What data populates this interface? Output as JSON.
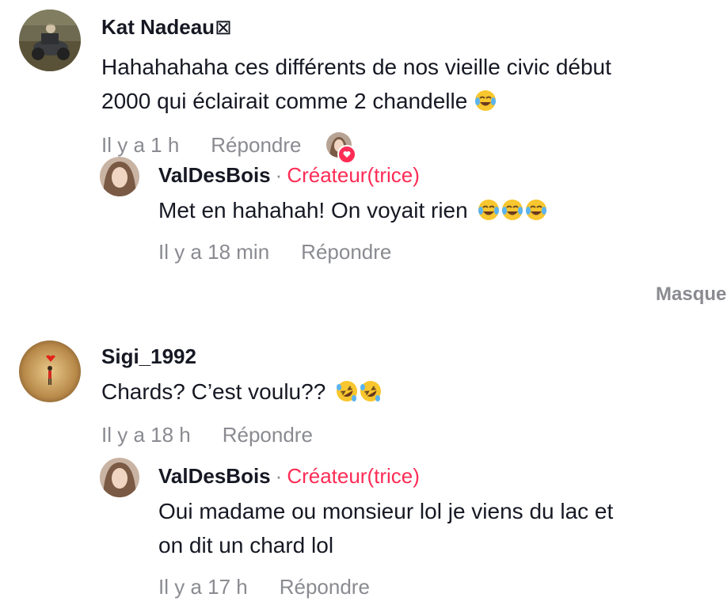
{
  "comments": [
    {
      "username": "Kat Nadeau",
      "username_suffix_glyph": "⊠",
      "text_line1": "Hahahahaha ces différents de nos vieille civic début",
      "text_line2": "2000 qui éclairait comme 2 chandelle",
      "emoji": "face-with-tears-of-joy",
      "time": "Il y a 1 h",
      "reply_label": "Répondre",
      "liked_by_creator": true,
      "replies": [
        {
          "username": "ValDesBois",
          "separator": "·",
          "role_badge": "Créateur(trice)",
          "text": "Met en hahahah! On voyait rien",
          "emoji": "face-with-tears-of-joy",
          "emoji_count": 3,
          "time": "Il y a 18 min",
          "reply_label": "Répondre"
        }
      ]
    },
    {
      "username": "Sigi_1992",
      "text": "Chards? C’est voulu??",
      "emoji": "rolling-on-floor-laughing",
      "emoji_count": 2,
      "time": "Il y a 18 h",
      "reply_label": "Répondre",
      "replies": [
        {
          "username": "ValDesBois",
          "separator": "·",
          "role_badge": "Créateur(trice)",
          "text_line1": "Oui madame ou monsieur lol je viens du lac et",
          "text_line2": "on dit un chard lol",
          "time": "Il y a 17 h",
          "reply_label": "Répondre"
        }
      ]
    }
  ],
  "hide_replies_label": "Masquer",
  "colors": {
    "creator_accent": "#fe2c55",
    "meta_gray": "#8a8b91",
    "text": "#161823"
  }
}
